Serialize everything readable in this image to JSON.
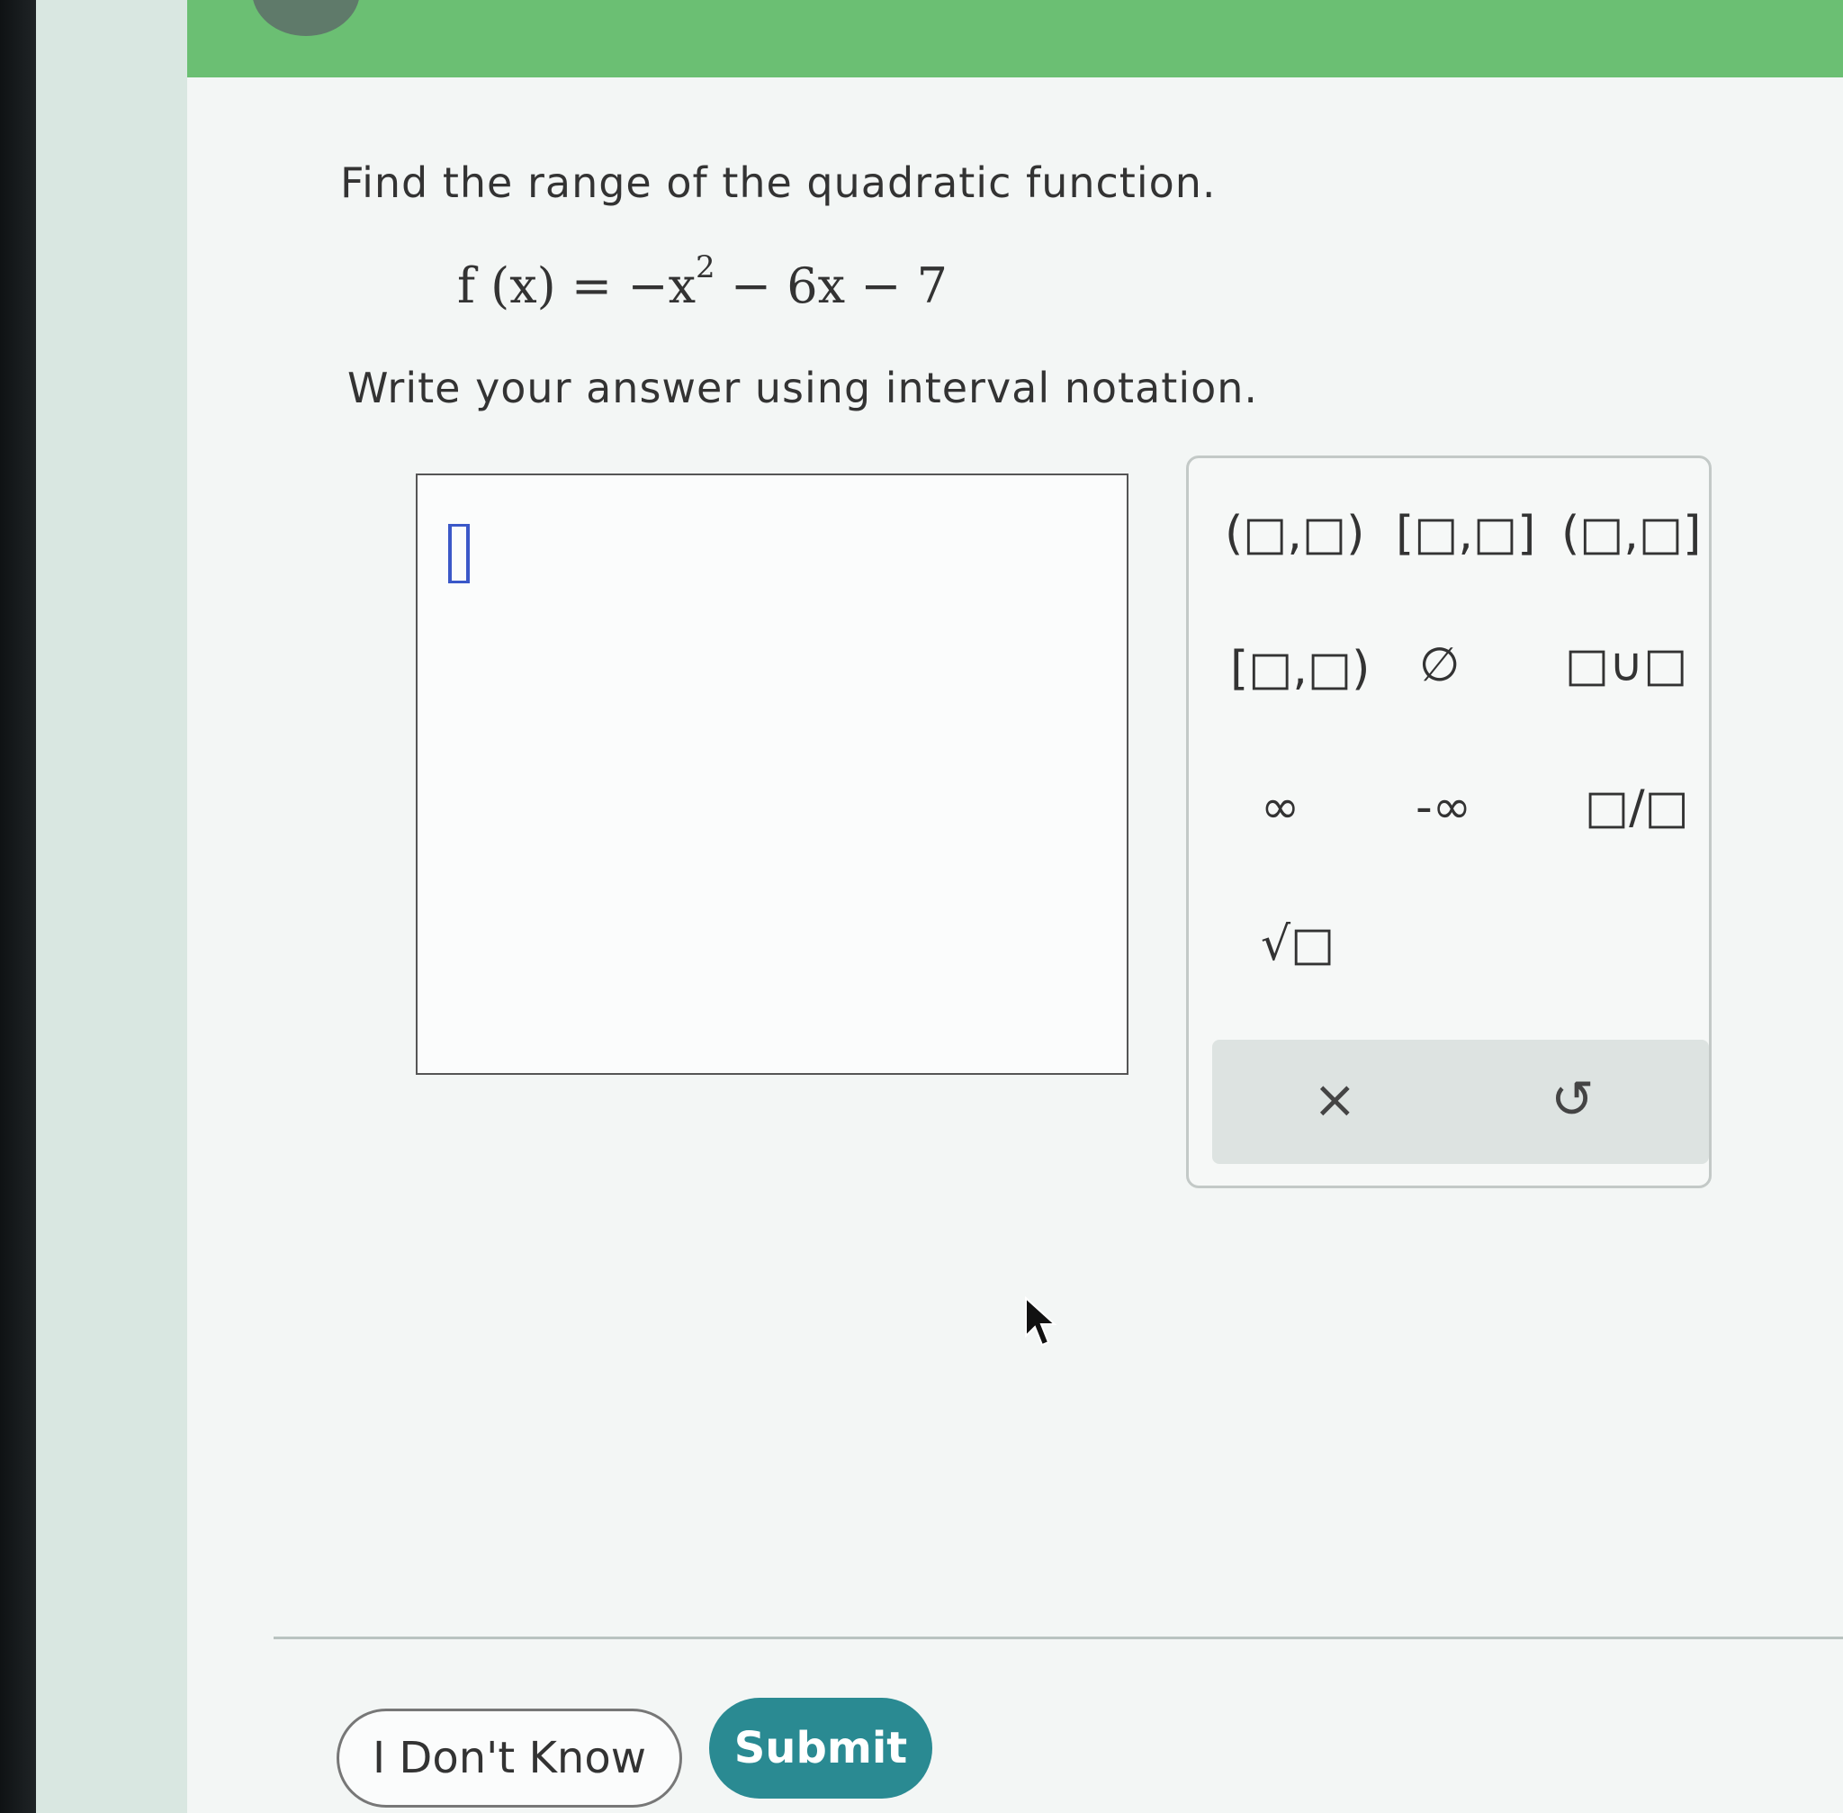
{
  "question": {
    "prompt": "Find the range of the quadratic function.",
    "function_left": "f (x) = −x",
    "function_exponent": "2",
    "function_right": " − 6x − 7",
    "instruction": "Write your answer using interval notation."
  },
  "palette": {
    "buttons": [
      "(□,□)",
      "[□,□]",
      "(□,□]",
      "[□,□)",
      "∅",
      "□∪□",
      "∞",
      "-∞",
      "□/□",
      "√□"
    ],
    "clear_label": "×",
    "undo_label": "↺"
  },
  "actions": {
    "dont_know": "I Don't Know",
    "submit": "Submit"
  },
  "colors": {
    "top_bar": "#6bbf73",
    "submit": "#2a8a92",
    "cursor": "#3b58c8"
  }
}
